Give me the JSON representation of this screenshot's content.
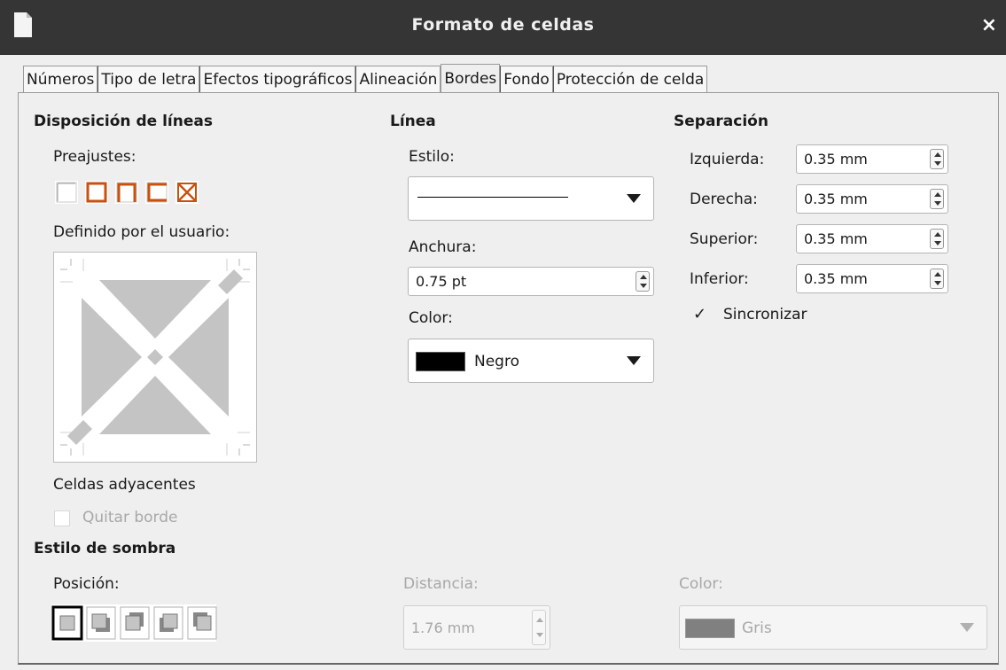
{
  "window": {
    "title": "Formato de celdas",
    "close_glyph": "×"
  },
  "tabs": [
    {
      "label": "Números",
      "active": false
    },
    {
      "label": "Tipo de letra",
      "active": false
    },
    {
      "label": "Efectos tipográficos",
      "active": false
    },
    {
      "label": "Alineación",
      "active": false
    },
    {
      "label": "Bordes",
      "active": true
    },
    {
      "label": "Fondo",
      "active": false
    },
    {
      "label": "Protección de celda",
      "active": false
    }
  ],
  "line_arrangement": {
    "heading": "Disposición de líneas",
    "presets_label": "Preajustes:",
    "user_defined_label": "Definido por el usuario:",
    "accent_color": "#c8510c"
  },
  "adjacent": {
    "heading": "Celdas adyacentes",
    "remove_border_label": "Quitar borde",
    "remove_border_checked": false,
    "remove_border_enabled": false
  },
  "line": {
    "heading": "Línea",
    "style_label": "Estilo:",
    "width_label": "Anchura:",
    "width_value": "0.75 pt",
    "color_label": "Color:",
    "color_value": "Negro",
    "color_swatch": "#000000"
  },
  "padding": {
    "heading": "Separación",
    "left_label": "Izquierda:",
    "left_value": "0.35 mm",
    "right_label": "Derecha:",
    "right_value": "0.35 mm",
    "top_label": "Superior:",
    "top_value": "0.35 mm",
    "bottom_label": "Inferior:",
    "bottom_value": "0.35 mm",
    "sync_label": "Sincronizar",
    "sync_checked": true
  },
  "shadow": {
    "heading": "Estilo de sombra",
    "position_label": "Posición:",
    "distance_label": "Distancia:",
    "distance_value": "1.76 mm",
    "color_label": "Color:",
    "color_value": "Gris",
    "color_swatch": "#808080"
  }
}
